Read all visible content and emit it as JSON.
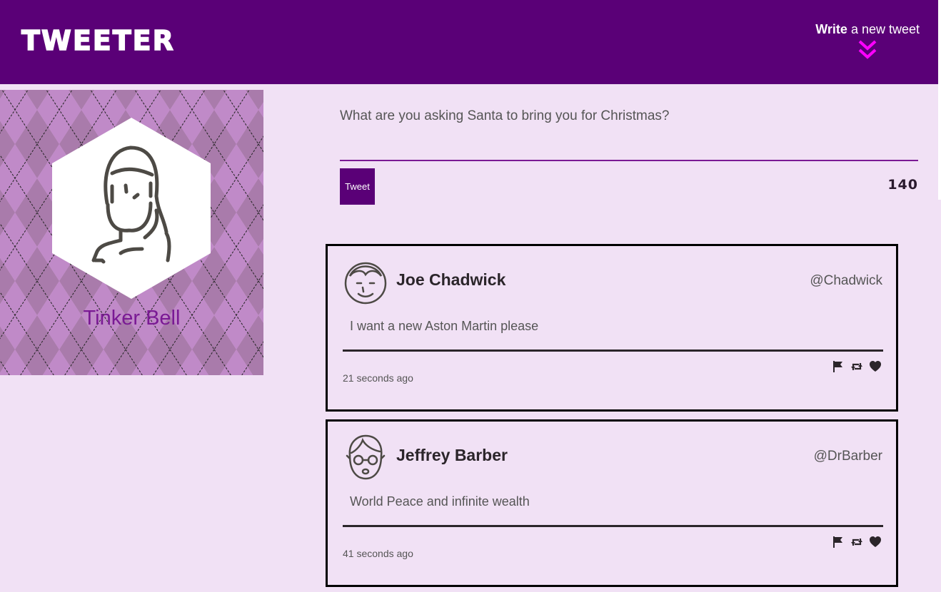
{
  "nav": {
    "brand": "TWEETER",
    "compose_toggle_bold": "Write",
    "compose_toggle_rest": " a new tweet"
  },
  "profile": {
    "name": "Tinker Bell"
  },
  "composer": {
    "placeholder": "What are you asking Santa to bring you for Christmas?",
    "button_label": "Tweet",
    "char_count": "140"
  },
  "tweets": [
    {
      "name": "Joe Chadwick",
      "handle": "@Chadwick",
      "body": "I want a new Aston Martin please",
      "time": "21 seconds ago"
    },
    {
      "name": "Jeffrey Barber",
      "handle": "@DrBarber",
      "body": "World Peace and infinite wealth",
      "time": "41 seconds ago"
    }
  ],
  "colors": {
    "nav_bg": "#5a0077",
    "page_bg": "#f1e1f5",
    "accent": "#7a1a94",
    "chevron": "#ff00ff"
  }
}
